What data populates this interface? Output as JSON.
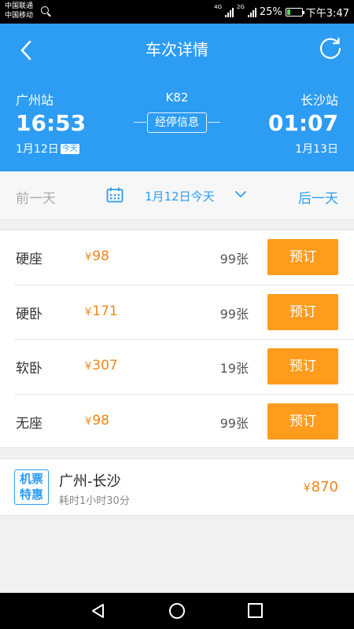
{
  "status_bar": {
    "carrier_1": "中国联通",
    "carrier_2": "中国移动",
    "network_1": "4G",
    "network_2": "2G",
    "battery": "25%",
    "battery_level": 0.25,
    "time": "下午3:47"
  },
  "header": {
    "title": "车次详情",
    "from_station": "广州站",
    "to_station": "长沙站",
    "train_no": "K82",
    "depart_time": "16:53",
    "arrive_time": "01:07",
    "stops_button": "经停信息",
    "depart_date": "1月12日",
    "today_badge": "今天",
    "arrive_date": "1月13日",
    "bg_color": "#2d9cf3"
  },
  "date_bar": {
    "prev_label": "前一天",
    "current": "1月12日今天",
    "next_label": "后一天"
  },
  "seats": [
    {
      "type": "硬座",
      "currency": "¥",
      "price": "98",
      "count": "99张",
      "button": "预订"
    },
    {
      "type": "硬卧",
      "currency": "¥",
      "price": "171",
      "count": "99张",
      "button": "预订"
    },
    {
      "type": "软卧",
      "currency": "¥",
      "price": "307",
      "count": "19张",
      "button": "预订"
    },
    {
      "type": "无座",
      "currency": "¥",
      "price": "98",
      "count": "99张",
      "button": "预订"
    }
  ],
  "flight": {
    "badge_line1": "机票",
    "badge_line2": "特惠",
    "route": "广州-长沙",
    "duration": "耗时1小时30分",
    "currency": "¥",
    "price": "870"
  },
  "colors": {
    "accent": "#2d9cf3",
    "price": "#f08519",
    "book_button": "#ff9c1d"
  },
  "icons": {
    "back": "back-arrow-icon",
    "refresh": "refresh-icon",
    "calendar": "calendar-icon",
    "dropdown": "chevron-down-icon"
  }
}
